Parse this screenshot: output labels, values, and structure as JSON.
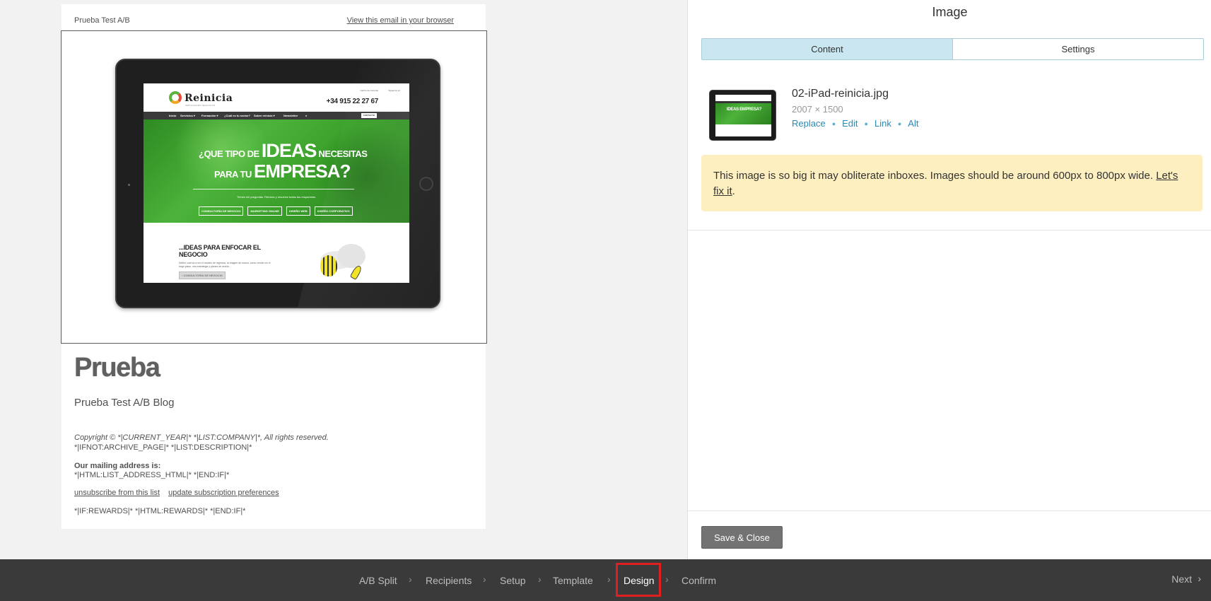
{
  "email": {
    "preheader_subject": "Prueba Test A/B",
    "view_in_browser": "View this email in your browser",
    "title": "Prueba",
    "subtitle": "Prueba Test A/B Blog",
    "copyright": "Copyright © *|CURRENT_YEAR|* *|LIST:COMPANY|*, All rights reserved.",
    "archive_line": "*|IFNOT:ARCHIVE_PAGE|* *|LIST:DESCRIPTION|*",
    "mailing_heading": "Our mailing address is:",
    "mailing_address": "*|HTML:LIST_ADDRESS_HTML|* *|END:IF|*",
    "unsubscribe": "unsubscribe from this list",
    "update_prefs": "update subscription preferences",
    "rewards": "*|IF:REWARDS|* *|HTML:REWARDS|* *|END:IF|*"
  },
  "screen": {
    "logo": "Reinicia",
    "logo_sub": "IMPULSANDO NEGOCIOS",
    "top_small_1": "Carrito de compras",
    "top_small_2": "Síguenos en:",
    "phone": "+34 915 22 27 67",
    "nav": [
      "Inicio",
      "Servicios ▾",
      "Formación ▾",
      "¿Cuál es tu sector?",
      "Sobre reinicia ▾",
      "Newsletter"
    ],
    "contact": "CONTACTO",
    "hero_line1_pre": "¿QUE TIPO DE",
    "hero_line1_big": "IDEAS",
    "hero_line1_post": "NECESITAS",
    "hero_line2_pre": "PARA TU",
    "hero_line2_big": "EMPRESA?",
    "hero_tag": "Tienes mil preguntas. Reinicia y resuelve todas tus respuestas.",
    "hero_buttons": [
      "CONSULTORÍA DE NEGOCIO",
      "MARKETING ONLINE",
      "DISEÑO WEB",
      "DISEÑO CORPORATIVO"
    ],
    "body_title": "...IDEAS PARA ENFOCAR EL NEGOCIO",
    "body_text": "Definir cuál va a ser el modelo de ingresos, la imagen de marca, cómo vender en el largo plazo, una estrategia y planes de acción...",
    "body_button": "› CONSULTORÍA DE NEGOCIO"
  },
  "editor": {
    "title": "Image",
    "tabs": [
      {
        "label": "Content",
        "active": true
      },
      {
        "label": "Settings",
        "active": false
      }
    ],
    "file_name": "02-iPad-reinicia.jpg",
    "file_dims": "2007 × 1500",
    "actions": [
      "Replace",
      "Edit",
      "Link",
      "Alt"
    ],
    "thumb_text": "IDEAS EMPRESA?",
    "warning_text": "This image is so big it may obliterate inboxes. Images should be around 600px to 800px wide.",
    "warning_link": "Let's fix it",
    "warning_end": ".",
    "save_label": "Save & Close"
  },
  "steps": {
    "items": [
      {
        "label": "A/B Split",
        "active": false
      },
      {
        "label": "Recipients",
        "active": false
      },
      {
        "label": "Setup",
        "active": false
      },
      {
        "label": "Template",
        "active": false
      },
      {
        "label": "Design",
        "active": true
      },
      {
        "label": "Confirm",
        "active": false
      }
    ],
    "next": "Next"
  },
  "colors": {
    "accent_link": "#2b8ab5",
    "tab_active": "#cae7f1",
    "warning_bg": "#fdefc0",
    "bottom_bar": "#3a3a3a",
    "highlight": "#e02020"
  }
}
